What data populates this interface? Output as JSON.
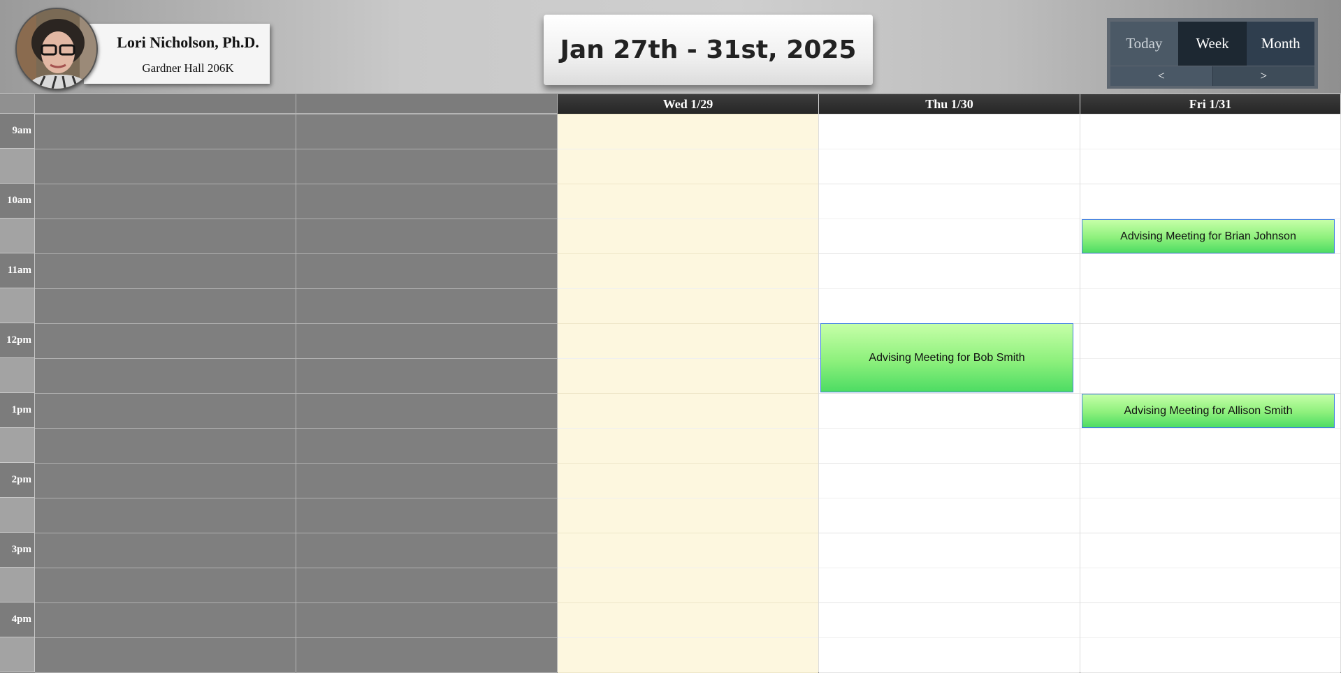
{
  "profile": {
    "name": "Lori Nicholson, Ph.D.",
    "office": "Gardner Hall 206K"
  },
  "range_title": "Jan 27th - 31st, 2025",
  "nav": {
    "today_label": "Today",
    "week_label": "Week",
    "month_label": "Month",
    "active_view": "Week",
    "prev_label": "<",
    "next_label": ">"
  },
  "days": [
    {
      "label": "",
      "state": "disabled"
    },
    {
      "label": "",
      "state": "disabled"
    },
    {
      "label": "Wed 1/29",
      "state": "today"
    },
    {
      "label": "Thu 1/30",
      "state": "normal"
    },
    {
      "label": "Fri 1/31",
      "state": "normal"
    }
  ],
  "time_labels": [
    "9am",
    "10am",
    "11am",
    "12pm",
    "1pm",
    "2pm",
    "3pm",
    "4pm"
  ],
  "events": [
    {
      "day": "Fri 1/31",
      "start": "10:30am",
      "end": "11am",
      "title": "Advising Meeting for Brian Johnson"
    },
    {
      "day": "Thu 1/30",
      "start": "12pm",
      "end": "1pm",
      "title": "Advising Meeting for Bob Smith"
    },
    {
      "day": "Fri 1/31",
      "start": "1pm",
      "end": "1:30pm",
      "title": "Advising Meeting for Allison Smith"
    }
  ],
  "colors": {
    "today_column": "#fdf7df",
    "event_green": "#8df07c",
    "event_border": "#3f7fe0",
    "header_dark": "#262626"
  }
}
